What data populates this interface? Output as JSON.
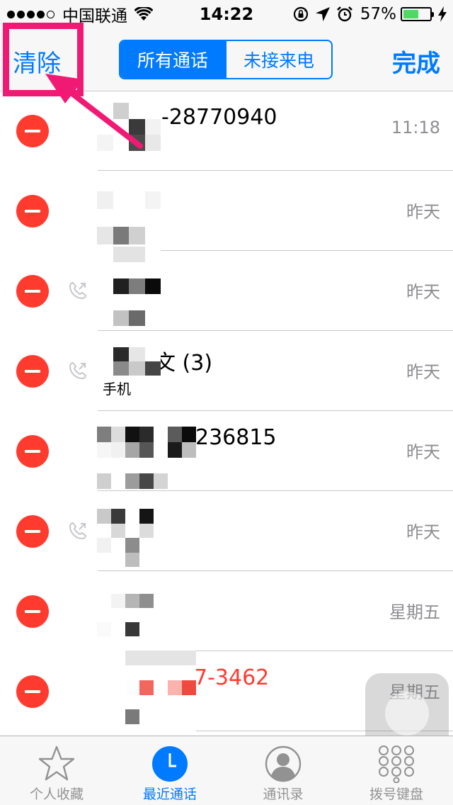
{
  "status_bar": {
    "carrier": "中国联通",
    "time": "14:22",
    "battery_percent": "57%",
    "battery_level": 0.57,
    "battery_color": "#4cd964",
    "icons": [
      "signal-dots",
      "wifi-icon",
      "rotation-lock-icon",
      "location-icon",
      "alarm-icon",
      "battery-icon",
      "charging-icon"
    ]
  },
  "nav": {
    "left_button": "清除",
    "segments": [
      "所有通话",
      "未接来电"
    ],
    "active_segment": 0,
    "right_button": "完成",
    "accent_color": "#007aff"
  },
  "calls": [
    {
      "name": "-28770940",
      "label": "",
      "time": "11:18",
      "outgoing": false,
      "missed": false
    },
    {
      "name": "",
      "label": "",
      "time": "昨天",
      "outgoing": false,
      "missed": false
    },
    {
      "name": "",
      "label": "",
      "time": "昨天",
      "outgoing": true,
      "missed": false
    },
    {
      "name": "文 (3)",
      "label": "手机",
      "time": "昨天",
      "outgoing": true,
      "missed": false
    },
    {
      "name": "236815",
      "label": "",
      "time": "昨天",
      "outgoing": false,
      "missed": false
    },
    {
      "name": "",
      "label": "",
      "time": "昨天",
      "outgoing": true,
      "missed": false
    },
    {
      "name": "",
      "label": "",
      "time": "星期五",
      "outgoing": false,
      "missed": false
    },
    {
      "name": "7-3462",
      "label": "",
      "time": "星期五",
      "outgoing": false,
      "missed": true
    }
  ],
  "tabs": [
    {
      "label": "个人收藏",
      "icon": "star-icon",
      "active": false
    },
    {
      "label": "最近通话",
      "icon": "clock-icon",
      "active": true
    },
    {
      "label": "通讯录",
      "icon": "contacts-icon",
      "active": false
    },
    {
      "label": "拨号键盘",
      "icon": "keypad-icon",
      "active": false
    }
  ],
  "colors": {
    "delete": "#ff3b30",
    "missed": "#ff3b30",
    "annotation": "#f01a74",
    "secondary_text": "#8e8e93"
  }
}
